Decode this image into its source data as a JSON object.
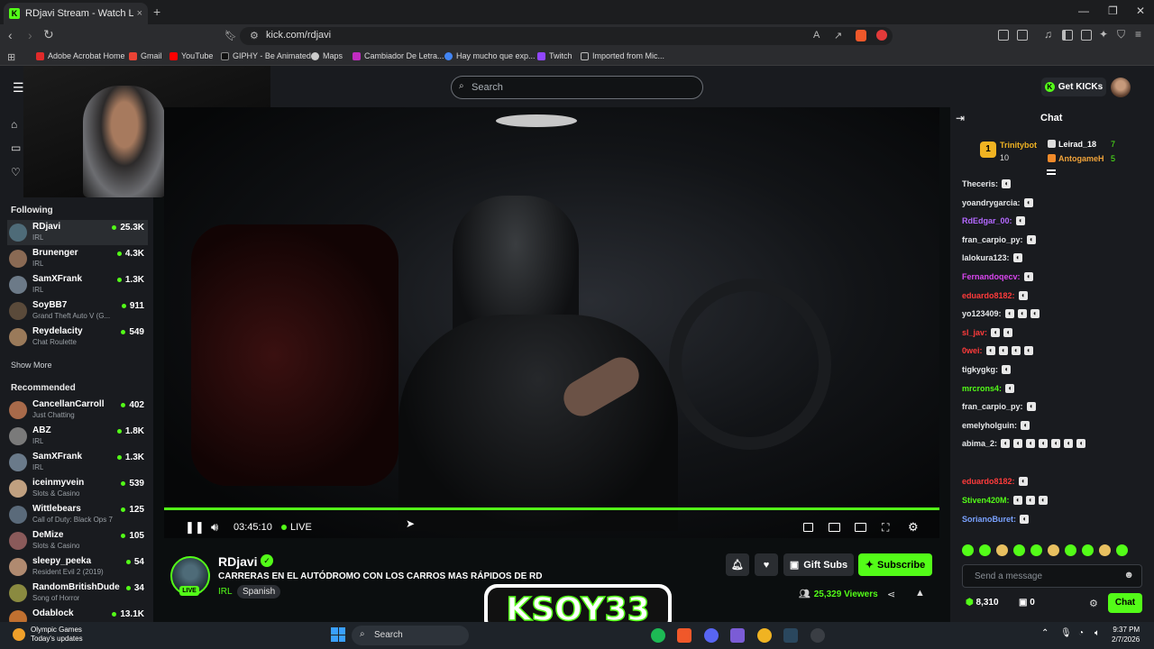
{
  "browser": {
    "tab_title": "RDjavi Stream - Watch Live o",
    "tab_close": "×",
    "new_tab": "+",
    "url": "kick.com/rdjavi",
    "bookmarks": [
      "Adobe Acrobat Home",
      "Gmail",
      "YouTube",
      "GIPHY - Be Animated",
      "Maps",
      "Cambiador De Letra...",
      "Hay mucho que exp...",
      "Twitch",
      "Imported from Mic..."
    ]
  },
  "header": {
    "search_placeholder": "Search",
    "get_kicks": "Get KICKs"
  },
  "sidebar": {
    "following_title": "Following",
    "following": [
      {
        "name": "RDjavi",
        "category": "IRL",
        "viewers": "25.3K"
      },
      {
        "name": "Brunenger",
        "category": "IRL",
        "viewers": "4.3K"
      },
      {
        "name": "SamXFrank",
        "category": "IRL",
        "viewers": "1.3K"
      },
      {
        "name": "SoyBB7",
        "category": "Grand Theft Auto V (G...",
        "viewers": "911"
      },
      {
        "name": "Reydelacity",
        "category": "Chat Roulette",
        "viewers": "549"
      }
    ],
    "show_more": "Show More",
    "recommended_title": "Recommended",
    "recommended": [
      {
        "name": "CancellanCarroll",
        "category": "Just Chatting",
        "viewers": "402"
      },
      {
        "name": "ABZ",
        "category": "IRL",
        "viewers": "1.8K"
      },
      {
        "name": "SamXFrank",
        "category": "IRL",
        "viewers": "1.3K"
      },
      {
        "name": "iceinmyvein",
        "category": "Slots & Casino",
        "viewers": "539"
      },
      {
        "name": "Wittlebears",
        "category": "Call of Duty: Black Ops 7",
        "viewers": "125"
      },
      {
        "name": "DeMize",
        "category": "Slots & Casino",
        "viewers": "105"
      },
      {
        "name": "sleepy_peeka",
        "category": "Resident Evil 2 (2019)",
        "viewers": "54"
      },
      {
        "name": "RandomBritishDude",
        "category": "Song of Horror",
        "viewers": "34"
      },
      {
        "name": "Odablock",
        "category": "",
        "viewers": "13.1K"
      }
    ]
  },
  "player": {
    "timecode": "03:45:10",
    "live": "LIVE",
    "progress": 1.0
  },
  "stream": {
    "channel": "RDjavi",
    "live_badge": "LIVE",
    "title": "CARRERAS EN EL AUTÓDROMO CON LOS CARROS MAS RÁPIDOS DE RD",
    "category": "IRL",
    "language": "Spanish",
    "gift_subs": "Gift Subs",
    "subscribe": "Subscribe",
    "viewers": "25,329 Viewers"
  },
  "overlay": {
    "logo_text": "KSOY33"
  },
  "chat": {
    "title": "Chat",
    "leaders": [
      {
        "name": "Trinitybot",
        "count": "10"
      },
      {
        "name": "Leirad_18",
        "count": "7"
      },
      {
        "name": "AntogameH",
        "count": "5"
      }
    ],
    "messages": [
      {
        "user": "Theceris:",
        "color": "#e6e8ea",
        "emotes": 1
      },
      {
        "user": "yoandrygarcia:",
        "color": "#e6e8ea",
        "emotes": 1
      },
      {
        "user": "RdEdgar_00:",
        "color": "#b469ff",
        "emotes": 1
      },
      {
        "user": "fran_carpio_py:",
        "color": "#e6e8ea",
        "emotes": 1
      },
      {
        "user": "lalokura123:",
        "color": "#e6e8ea",
        "emotes": 1
      },
      {
        "user": "Fernandoqecv:",
        "color": "#d946ef",
        "emotes": 1
      },
      {
        "user": "eduardo8182:",
        "color": "#ff3b3b",
        "emotes": 1
      },
      {
        "user": "yo123409:",
        "color": "#e6e8ea",
        "emotes": 3
      },
      {
        "user": "sl_jav:",
        "color": "#ff3b3b",
        "emotes": 2
      },
      {
        "user": "0wei:",
        "color": "#ff3b3b",
        "emotes": 4
      },
      {
        "user": "tigkygkg:",
        "color": "#e6e8ea",
        "emotes": 1
      },
      {
        "user": "mrcrons4:",
        "color": "#53fc18",
        "emotes": 1
      },
      {
        "user": "fran_carpio_py:",
        "color": "#e6e8ea",
        "emotes": 1
      },
      {
        "user": "emelyholguin:",
        "color": "#e6e8ea",
        "emotes": 1
      },
      {
        "user": "abima_2:",
        "color": "#e6e8ea",
        "emotes": 7
      },
      {
        "user": "eduardo8182:",
        "color": "#ff3b3b",
        "emotes": 1
      },
      {
        "user": "Stiven420M:",
        "color": "#53fc18",
        "emotes": 3
      },
      {
        "user": "SorianoBuret:",
        "color": "#7aa2ff",
        "emotes": 1
      }
    ],
    "send_placeholder": "Send a message",
    "points": "8,310",
    "points2": "0",
    "chat_button": "Chat"
  },
  "taskbar": {
    "weather_title": "Olympic Games",
    "weather_sub": "Today's updates",
    "search": "Search",
    "time": "9:37 PM",
    "date": "2/7/2026"
  },
  "colors": {
    "accent": "#53fc18",
    "bg": "#0b0e0f",
    "panel": "#191b1f"
  }
}
